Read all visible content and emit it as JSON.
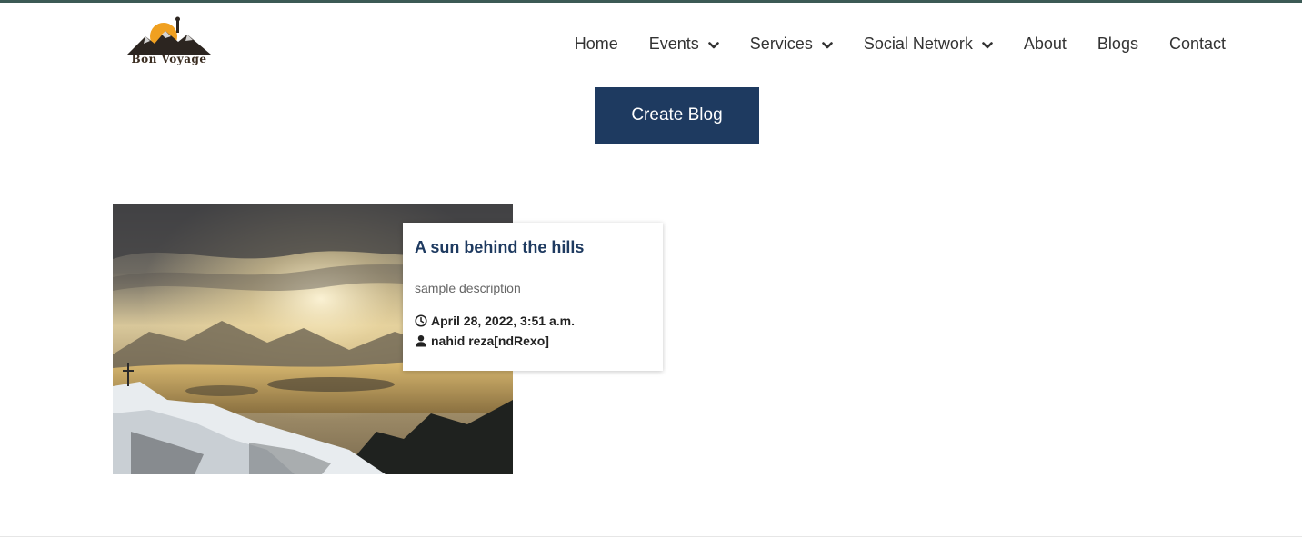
{
  "brand": {
    "logo_text": "Bon Voyage"
  },
  "nav": {
    "items": [
      {
        "label": "Home",
        "has_dropdown": false
      },
      {
        "label": "Events",
        "has_dropdown": true
      },
      {
        "label": "Services",
        "has_dropdown": true
      },
      {
        "label": "Social Network",
        "has_dropdown": true
      },
      {
        "label": "About",
        "has_dropdown": false
      },
      {
        "label": "Blogs",
        "has_dropdown": false
      },
      {
        "label": "Contact",
        "has_dropdown": false
      }
    ],
    "dropdown_icon": "chevron-down-icon"
  },
  "actions": {
    "create_blog_label": "Create Blog"
  },
  "blogs": [
    {
      "title": "A sun behind the hills",
      "description": "sample description",
      "date": "April 28, 2022, 3:51 a.m.",
      "author": "nahid reza[ndRexo]",
      "date_icon": "clock-icon",
      "author_icon": "user-icon"
    }
  ],
  "colors": {
    "primary": "#1e3a60",
    "topbar": "#3c5a55",
    "nav_text": "#333333",
    "desc_text": "#666666"
  }
}
